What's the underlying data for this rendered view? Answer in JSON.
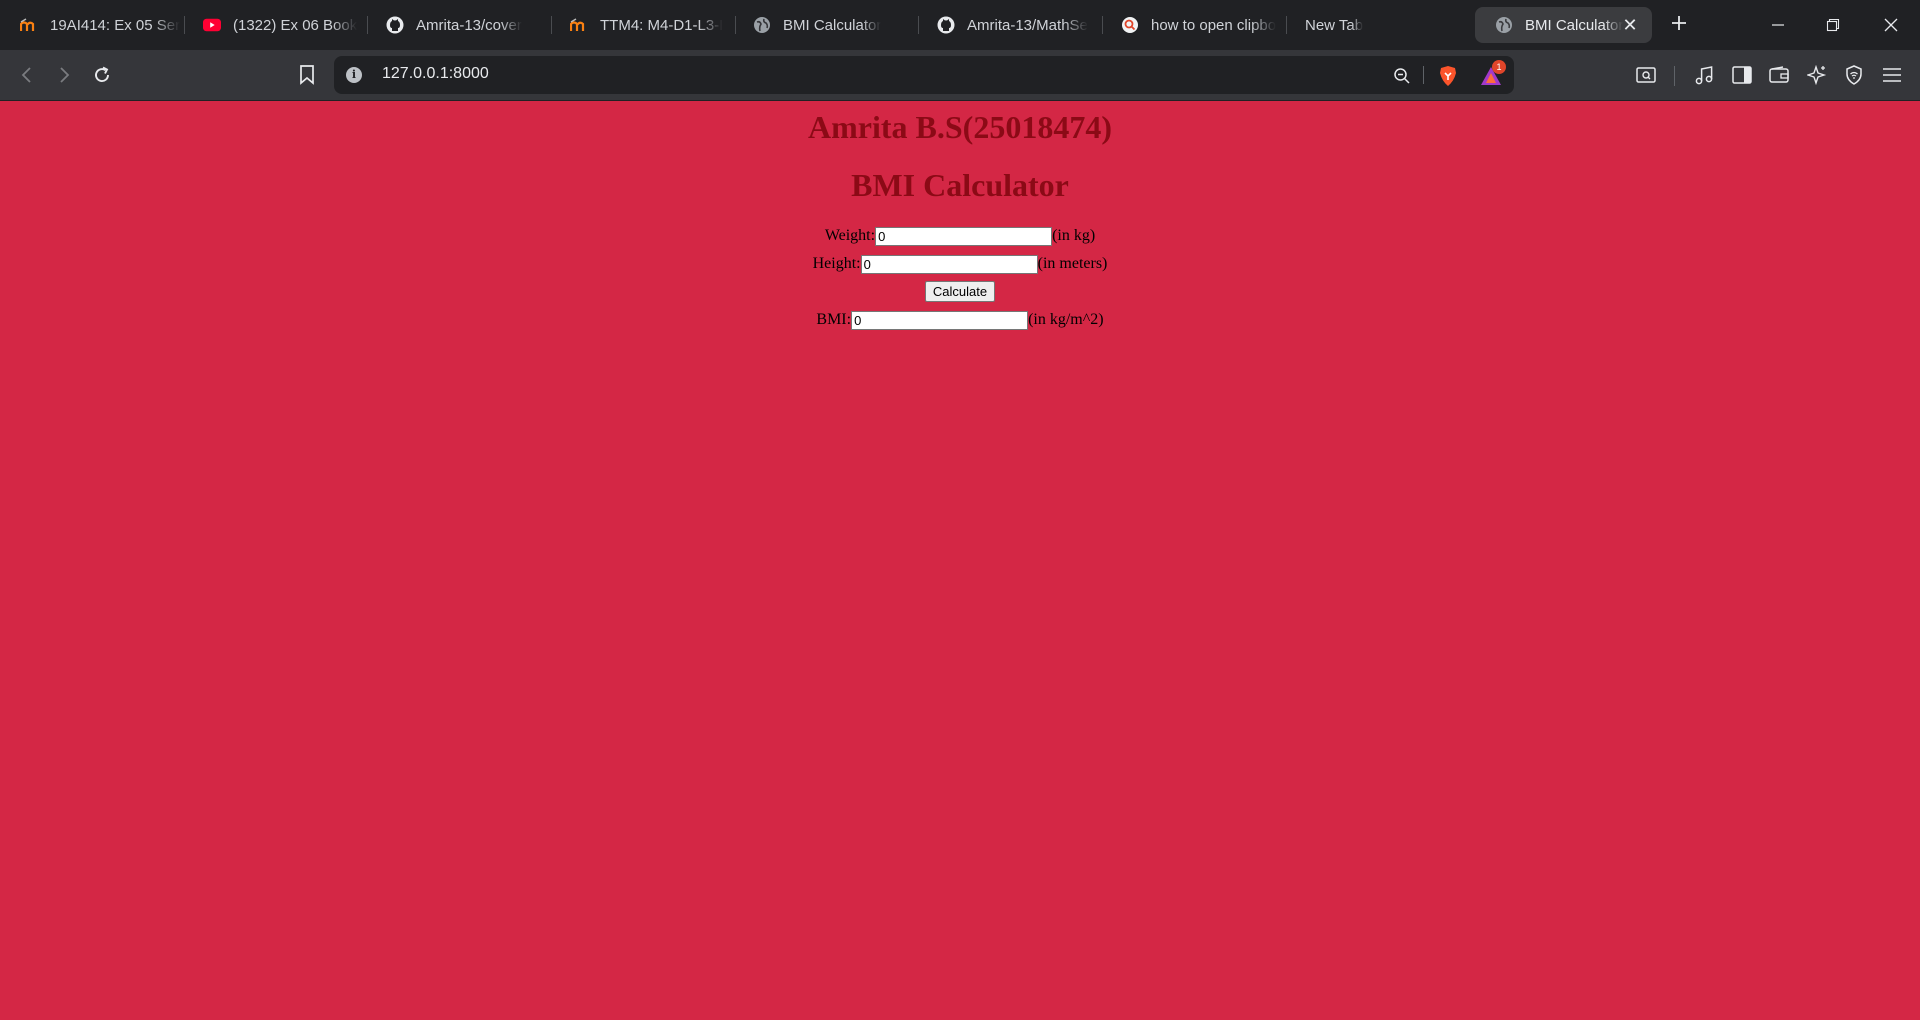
{
  "browser": {
    "tabs": [
      {
        "title": "19AI414: Ex 05 Ser",
        "icon": "moodle-icon"
      },
      {
        "title": "(1322) Ex 06 Book",
        "icon": "youtube-icon"
      },
      {
        "title": "Amrita-13/cover",
        "icon": "github-icon"
      },
      {
        "title": "TTM4: M4-D1-L3-I",
        "icon": "moodle-icon"
      },
      {
        "title": "BMI Calculator",
        "icon": "globe-icon"
      },
      {
        "title": "Amrita-13/MathSe",
        "icon": "github-icon"
      },
      {
        "title": "how to open clipbo",
        "icon": "search-icon"
      },
      {
        "title": "New Tab",
        "icon": ""
      },
      {
        "title": "BMI Calculator",
        "icon": "globe-icon",
        "active": true
      }
    ],
    "address_bar": {
      "url": "127.0.0.1:8000"
    },
    "rewards_badge": "1"
  },
  "page": {
    "author_heading": "Amrita B.S(25018474)",
    "title": "BMI Calculator",
    "weight": {
      "label": "Weight:",
      "value": "0",
      "unit": "(in kg)"
    },
    "height": {
      "label": "Height:",
      "value": "0",
      "unit": "(in meters)"
    },
    "calculate_label": "Calculate",
    "bmi": {
      "label": "BMI:",
      "value": "0",
      "unit": "(in kg/m^2)"
    },
    "colors": {
      "background": "#d42745",
      "heading": "#8b0a16"
    }
  }
}
